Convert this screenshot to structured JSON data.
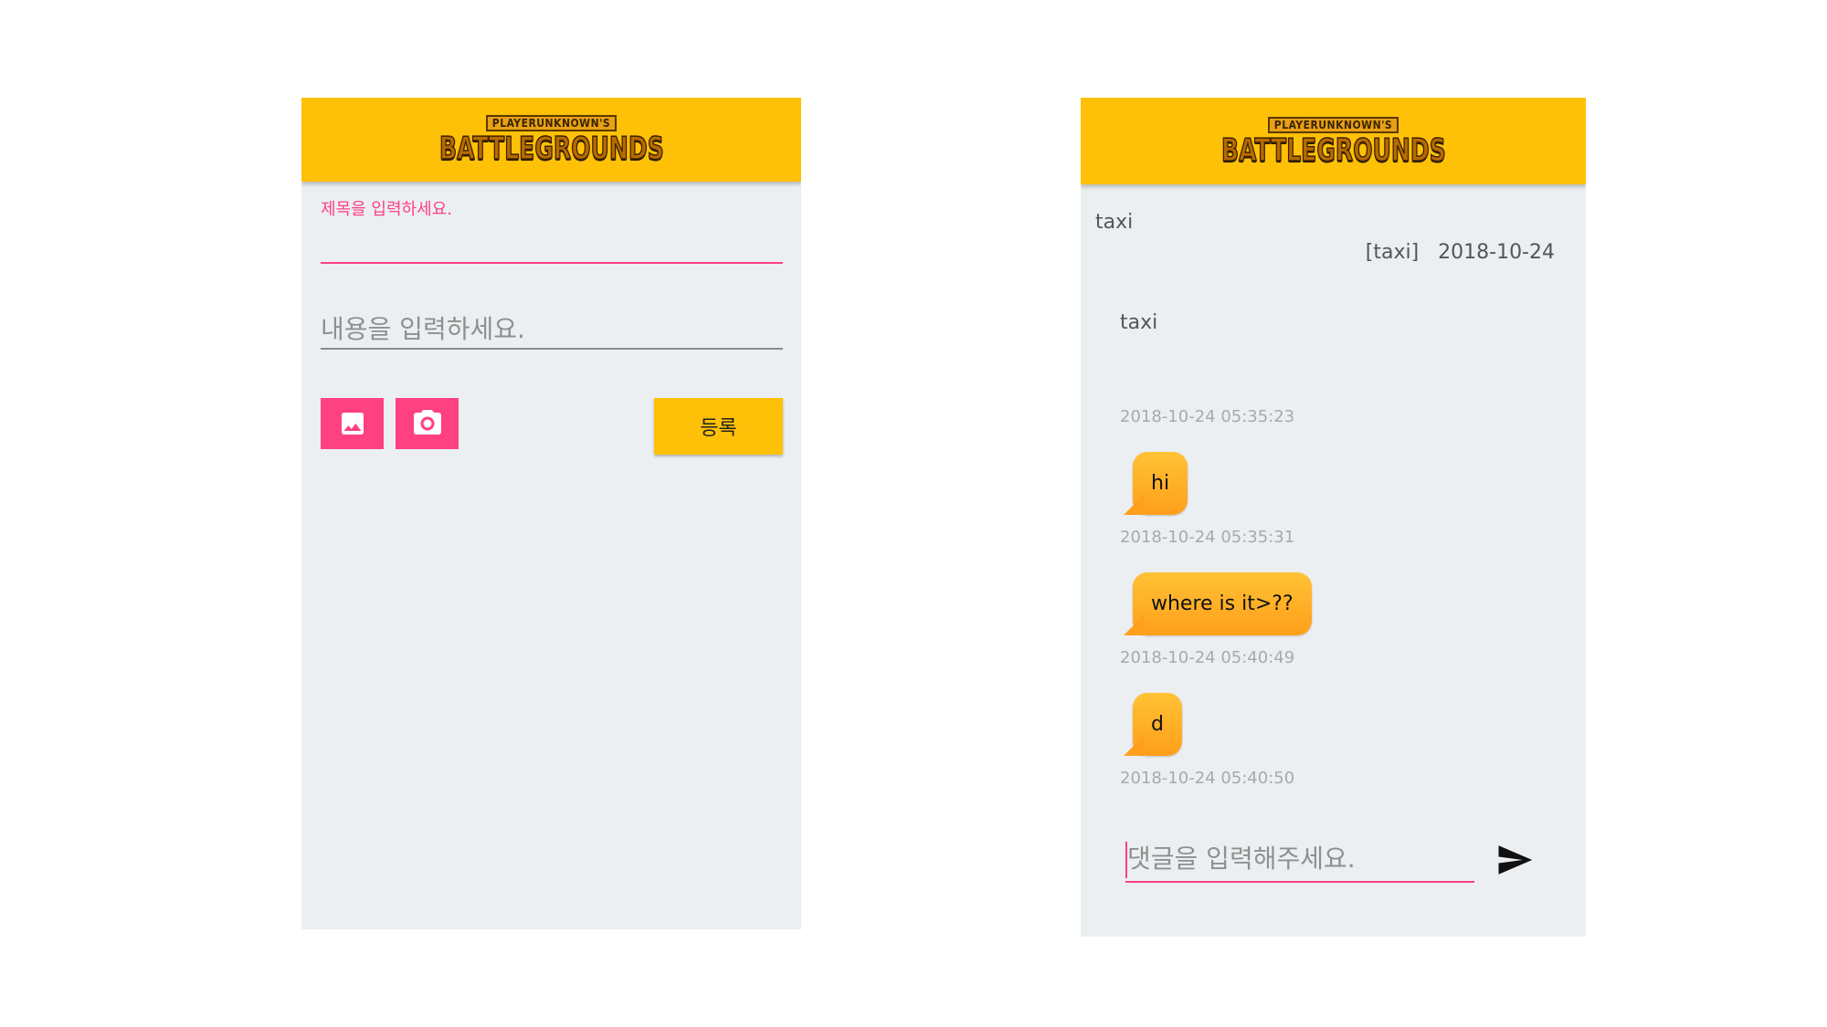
{
  "colors": {
    "appbar": "#ffc107",
    "accent": "#ff4081",
    "screen_background": "#eceff1",
    "bubble": "#ffa726"
  },
  "write_screen": {
    "logo": {
      "top_text": "PLAYERUNKNOWN'S",
      "main_text": "BATTLEGROUNDS"
    },
    "title_label": "제목을 입력하세요.",
    "title_value": "",
    "content_placeholder": "내용을 입력하세요.",
    "content_value": "",
    "gallery_icon": "image-icon",
    "camera_icon": "camera-icon",
    "register_label": "등록"
  },
  "detail_screen": {
    "logo": {
      "top_text": "PLAYERUNKNOWN'S",
      "main_text": "BATTLEGROUNDS"
    },
    "post_title": "taxi",
    "post_category": "[taxi]",
    "post_date": "2018-10-24",
    "post_body": "taxi",
    "post_timestamp": "2018-10-24 05:35:23",
    "comments": [
      {
        "text": "hi",
        "time": "2018-10-24 05:35:31"
      },
      {
        "text": "where is it>??",
        "time": "2018-10-24 05:40:49"
      },
      {
        "text": "d",
        "time": "2018-10-24 05:40:50"
      }
    ],
    "comment_placeholder": "댓글을 입력해주세요.",
    "send_icon": "send-icon"
  }
}
